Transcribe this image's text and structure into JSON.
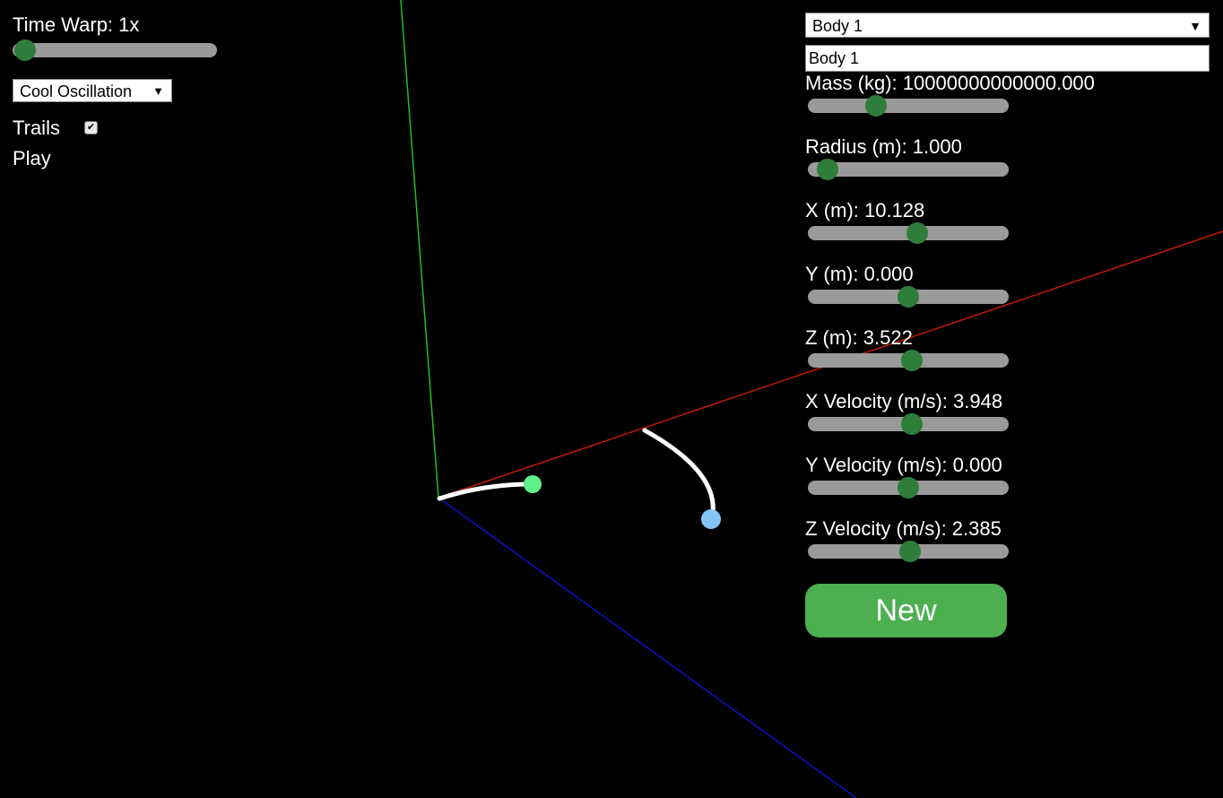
{
  "controls": {
    "time_warp_label": "Time Warp: 1x",
    "time_warp_level": 0.0,
    "preset_selected": "Cool Oscillation",
    "trails_label": "Trails",
    "trails_checked": true,
    "play_label": "Play"
  },
  "body_panel": {
    "selected_body": "Body 1",
    "name_value": "Body 1",
    "params": [
      {
        "label": "Mass (kg): 10000000000000.000",
        "level": 0.32
      },
      {
        "label": "Radius (m): 1.000",
        "level": 0.05
      },
      {
        "label": "X (m): 10.128",
        "level": 0.55
      },
      {
        "label": "Y (m): 0.000",
        "level": 0.5
      },
      {
        "label": "Z (m): 3.522",
        "level": 0.52
      },
      {
        "label": "X Velocity (m/s): 3.948",
        "level": 0.52
      },
      {
        "label": "Y Velocity (m/s): 0.000",
        "level": 0.5
      },
      {
        "label": "Z Velocity (m/s): 2.385",
        "level": 0.51
      }
    ],
    "new_label": "New"
  },
  "colors": {
    "background": "#000000",
    "y_axis": "#1fbf1f",
    "x_axis": "#c41a00",
    "z_axis": "#1010c8",
    "body1": "#5ef08a",
    "body2": "#86c6f5",
    "trail": "#ffffff",
    "slider_track": "#9a9a9a",
    "slider_thumb": "#2e7d3a",
    "new_button": "#4caf50"
  }
}
